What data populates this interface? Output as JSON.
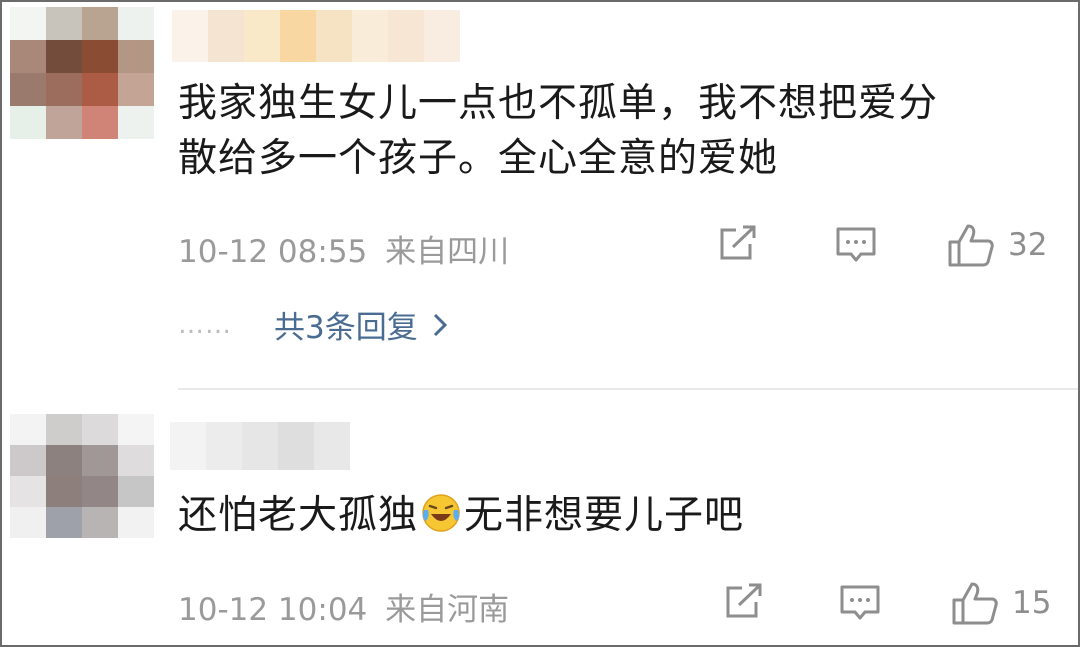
{
  "comments": [
    {
      "text_lines": [
        "我家独生女儿一点也不孤单，我不想把爱分",
        "散给多一个孩子。全心全意的爱她"
      ],
      "timestamp": "10-12 08:55",
      "location": "来自四川",
      "likes": "32",
      "replies_dots": "……",
      "replies_label": "共3条回复"
    },
    {
      "text_before_emoji": "还怕老大孤独",
      "emoji": "laugh-cry-emoji",
      "text_after_emoji": "无非想要儿子吧",
      "timestamp": "10-12 10:04",
      "location": "来自河南",
      "likes": "15"
    }
  ],
  "icons": {
    "share": "share-icon",
    "reply": "comment-icon",
    "like": "thumbs-up-icon",
    "chevron": "chevron-right-icon"
  },
  "colors": {
    "text": "#1a1a1a",
    "meta": "#9a9a9a",
    "link": "#4a6c93",
    "divider": "#e9e9e9"
  }
}
